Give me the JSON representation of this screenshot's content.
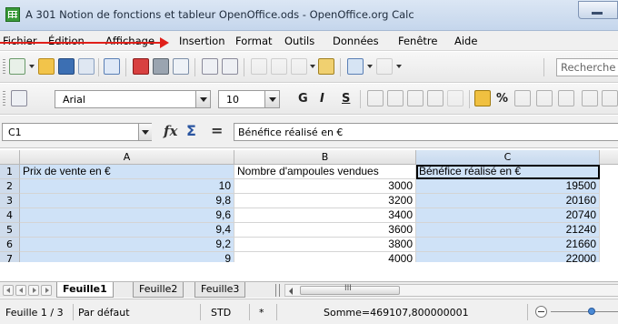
{
  "window": {
    "title": "A 301 Notion de fonctions et tableur OpenOffice.ods - OpenOffice.org Calc"
  },
  "menu": {
    "items": [
      "Fichier",
      "Édition",
      "Affichage",
      "Insertion",
      "Format",
      "Outils",
      "Données",
      "Fenêtre",
      "Aide"
    ]
  },
  "toolbar": {
    "search_placeholder": "Recherche"
  },
  "format_toolbar": {
    "font_name": "Arial",
    "font_size": "10",
    "bold_label": "G",
    "italic_label": "I",
    "underline_label": "S",
    "percent_label": "%"
  },
  "formula_bar": {
    "cell_reference": "C1",
    "fx_label": "fx",
    "sum_label": "Σ",
    "equal_label": "=",
    "content": "Bénéfice réalisé en €"
  },
  "sheet": {
    "columns": [
      "A",
      "B",
      "C"
    ],
    "rows": [
      {
        "n": "1",
        "a": "Prix de vente en €",
        "b": "Nombre d'ampoules vendues",
        "c": "Bénéfice réalisé en €"
      },
      {
        "n": "2",
        "a": "10",
        "b": "3000",
        "c": "19500"
      },
      {
        "n": "3",
        "a": "9,8",
        "b": "3200",
        "c": "20160"
      },
      {
        "n": "4",
        "a": "9,6",
        "b": "3400",
        "c": "20740"
      },
      {
        "n": "5",
        "a": "9,4",
        "b": "3600",
        "c": "21240"
      },
      {
        "n": "6",
        "a": "9,2",
        "b": "3800",
        "c": "21660"
      },
      {
        "n": "7",
        "a": "9",
        "b": "4000",
        "c": "22000"
      }
    ]
  },
  "tabs": {
    "sheets": [
      "Feuille1",
      "Feuille2",
      "Feuille3"
    ],
    "scroll_glyph": "III"
  },
  "status": {
    "page": "Feuille 1 / 3",
    "style": "Par défaut",
    "mode": "STD",
    "modified": "*",
    "sum": "Somme=469107,800000001"
  },
  "colors": {
    "selection": "#cfe2f7",
    "annotation_arrow": "#e0201a"
  }
}
